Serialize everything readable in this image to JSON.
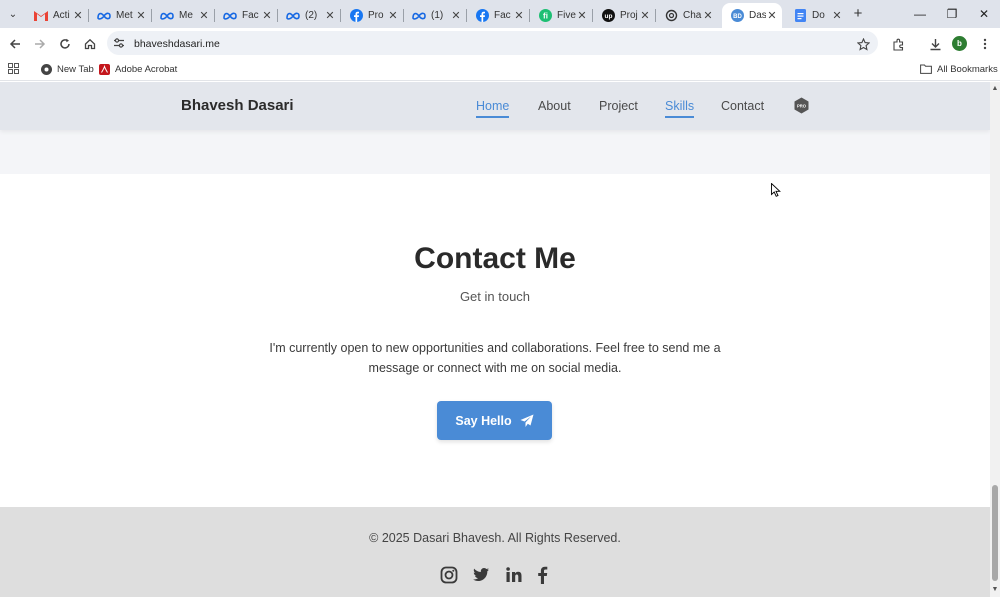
{
  "browser": {
    "tabs": [
      {
        "label": "Acti",
        "icon": "gmail-icon"
      },
      {
        "label": "Met",
        "icon": "meta-icon"
      },
      {
        "label": "Me",
        "icon": "meta-icon"
      },
      {
        "label": "Fac",
        "icon": "meta-icon"
      },
      {
        "label": "(2)",
        "icon": "meta-icon"
      },
      {
        "label": "Pro",
        "icon": "facebook-icon"
      },
      {
        "label": "(1)",
        "icon": "meta-icon"
      },
      {
        "label": "Fac",
        "icon": "facebook-icon"
      },
      {
        "label": "Five",
        "icon": "fiverr-icon"
      },
      {
        "label": "Proj",
        "icon": "upwork-icon"
      },
      {
        "label": "Cha",
        "icon": "openai-icon"
      },
      {
        "label": "Das",
        "icon": "site-icon",
        "active": true
      },
      {
        "label": "Do",
        "icon": "docs-icon"
      }
    ],
    "url": "bhaveshdasari.me",
    "profile_initial": "b",
    "bookmarks": [
      {
        "label": "New Tab",
        "icon": "chrome-icon"
      },
      {
        "label": "Adobe Acrobat",
        "icon": "acrobat-icon"
      }
    ],
    "all_bookmarks_label": "All Bookmarks"
  },
  "site": {
    "brand": "Bhavesh Dasari",
    "nav": [
      {
        "label": "Home",
        "active": true
      },
      {
        "label": "About",
        "active": false
      },
      {
        "label": "Project",
        "active": false
      },
      {
        "label": "Skills",
        "active": true
      },
      {
        "label": "Contact",
        "active": false
      }
    ],
    "nav_badge_text": "PRO",
    "contact": {
      "title": "Contact Me",
      "subtitle": "Get in touch",
      "text": "I'm currently open to new opportunities and collaborations. Feel free to send me a message or connect with me on social media.",
      "button": "Say Hello"
    },
    "footer": {
      "copyright": "© 2025 Dasari Bhavesh. All Rights Reserved.",
      "social": [
        "instagram-icon",
        "twitter-icon",
        "linkedin-icon",
        "facebook-icon"
      ]
    }
  },
  "colors": {
    "accent": "#4a8bd6",
    "navbar_bg": "#e3e6ec",
    "footer_bg": "#dedede"
  }
}
